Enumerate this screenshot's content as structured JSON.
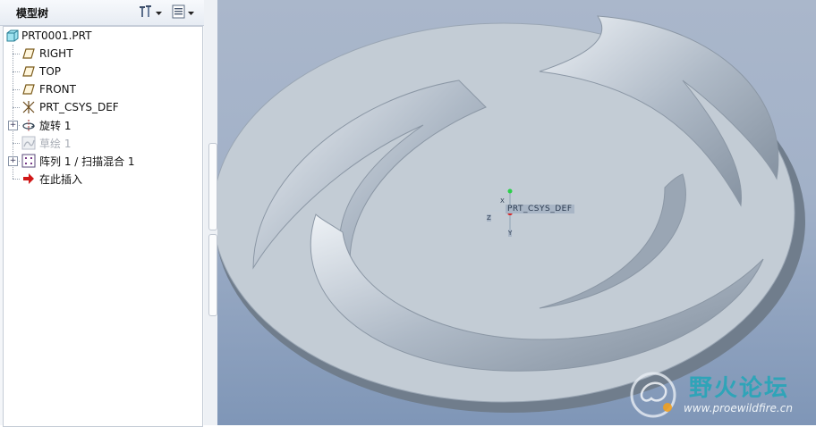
{
  "panel": {
    "title": "模型树"
  },
  "toolbar": {
    "settings_icon": "tools-icon",
    "show_icon": "list-icon"
  },
  "tree": {
    "root": "PRT0001.PRT",
    "items": [
      {
        "label": "RIGHT",
        "icon": "datum-plane-icon",
        "expandable": false,
        "suppressed": false
      },
      {
        "label": "TOP",
        "icon": "datum-plane-icon",
        "expandable": false,
        "suppressed": false
      },
      {
        "label": "FRONT",
        "icon": "datum-plane-icon",
        "expandable": false,
        "suppressed": false
      },
      {
        "label": "PRT_CSYS_DEF",
        "icon": "coordinate-system-icon",
        "expandable": false,
        "suppressed": false
      },
      {
        "label": "旋转 1",
        "icon": "revolve-icon",
        "expandable": true,
        "suppressed": false
      },
      {
        "label": "草绘 1",
        "icon": "sketch-icon",
        "expandable": false,
        "suppressed": true
      },
      {
        "label": "阵列 1 / 扫描混合 1",
        "icon": "pattern-icon",
        "expandable": true,
        "suppressed": false
      },
      {
        "label": "在此插入",
        "icon": "insert-here-arrow-icon",
        "expandable": false,
        "suppressed": false
      }
    ]
  },
  "viewport": {
    "csys_label": "PRT_CSYS_DEF",
    "axis_x": "X",
    "axis_y": "Y",
    "axis_z": "Z"
  },
  "watermark": {
    "title": "野火论坛",
    "url": "www.proewildfire.cn"
  }
}
